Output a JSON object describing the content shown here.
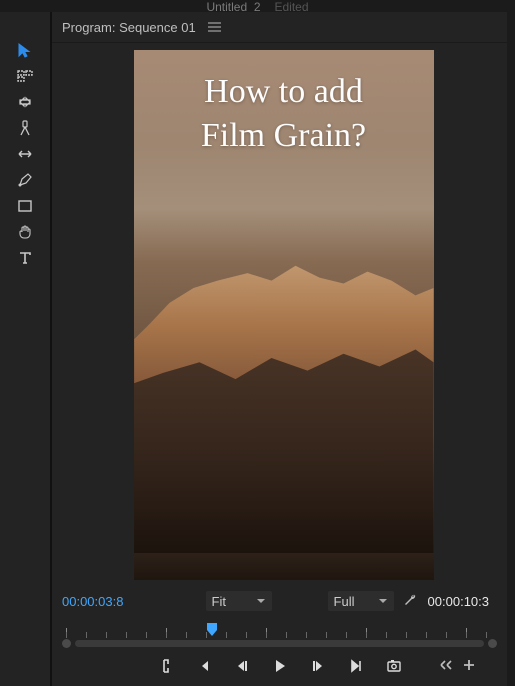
{
  "document": {
    "name": "Untitled_2",
    "state": "Edited"
  },
  "panel": {
    "title": "Program: Sequence 01"
  },
  "preview": {
    "overlay_text": "How to add\nFilm Grain?"
  },
  "transport": {
    "time_in": "00:00:03:8",
    "time_out": "00:00:10:3",
    "zoom_label": "Fit",
    "resolution_label": "Full"
  },
  "toolbar": {
    "tools": [
      "selection",
      "track-select",
      "ripple-edit",
      "razor",
      "slip",
      "pen",
      "rectangle",
      "hand",
      "type"
    ]
  },
  "icons": {
    "selection": "selection-tool-icon",
    "track_select": "track-select-icon",
    "ripple": "ripple-edit-icon",
    "razor": "razor-icon",
    "slip": "slip-tool-icon",
    "pen": "pen-tool-icon",
    "rectangle": "rectangle-tool-icon",
    "hand": "hand-tool-icon",
    "type": "type-tool-icon"
  }
}
